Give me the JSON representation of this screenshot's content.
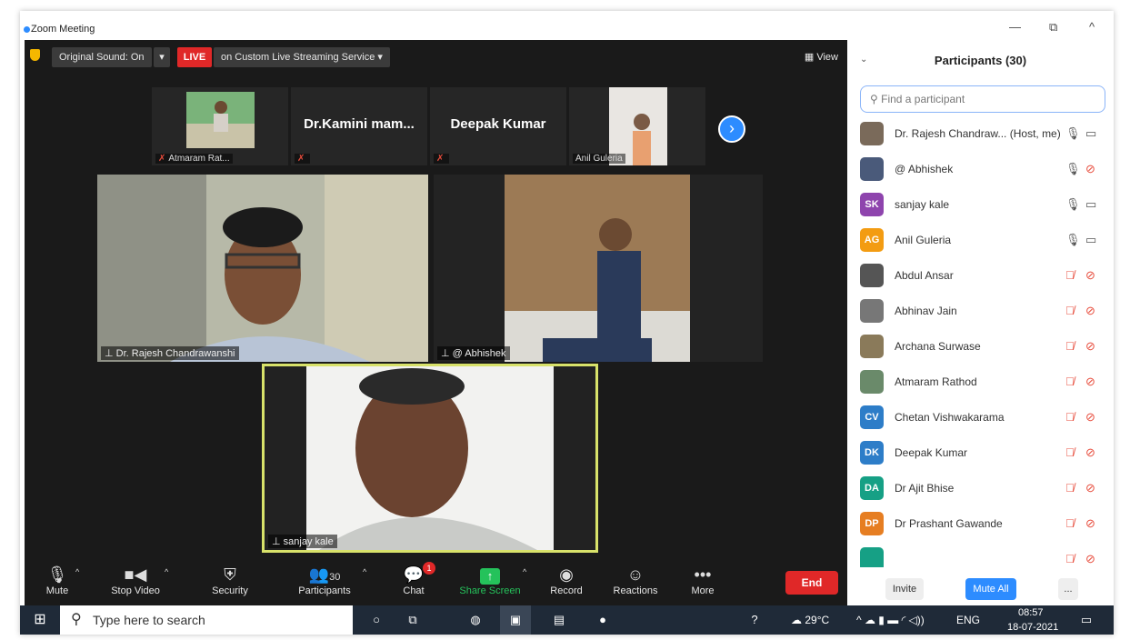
{
  "window": {
    "title": "Zoom Meeting",
    "minimize": "—",
    "restore": "⧉",
    "collapse": "^"
  },
  "topbar": {
    "sound": "Original Sound: On",
    "sound_caret": "▾",
    "live": "LIVE",
    "streaming": "on Custom Live Streaming Service  ▾",
    "view": "View"
  },
  "strip": [
    {
      "label": "Atmaram Rat...",
      "muted": true,
      "type": "video"
    },
    {
      "name": "Dr.Kamini  mam...",
      "muted": true,
      "type": "name"
    },
    {
      "name": "Deepak Kumar",
      "muted": true,
      "type": "name"
    },
    {
      "label": "Anil Guleria",
      "muted": false,
      "type": "video"
    }
  ],
  "strip_next": "›",
  "tiles": [
    {
      "label": "Dr. Rajesh Chandrawanshi"
    },
    {
      "label": "@ Abhishek"
    },
    {
      "label": "sanjay kale"
    }
  ],
  "pin_icon": "⊥",
  "toolbar": {
    "mute": "Mute",
    "stop_video": "Stop Video",
    "security": "Security",
    "participants": "Participants",
    "participants_count": "30",
    "chat": "Chat",
    "chat_badge": "1",
    "share_screen": "Share Screen",
    "record": "Record",
    "reactions": "Reactions",
    "more": "More",
    "end": "End"
  },
  "panel": {
    "title": "Participants (30)",
    "search_placeholder": "Find a participant",
    "participants": [
      {
        "name": "Dr. Rajesh Chandraw...  (Host, me)",
        "initials": "",
        "color": "#7a6a5a",
        "muted": false,
        "cam_off": false
      },
      {
        "name": "@ Abhishek",
        "initials": "",
        "color": "#4a5a7a",
        "muted": false,
        "cam_off": true
      },
      {
        "name": "sanjay kale",
        "initials": "SK",
        "color": "#8e44ad",
        "muted": false,
        "cam_off": false
      },
      {
        "name": "Anil Guleria",
        "initials": "AG",
        "color": "#f39c12",
        "muted": false,
        "cam_off": false
      },
      {
        "name": "Abdul Ansar",
        "initials": "",
        "color": "#555555",
        "muted": true,
        "cam_off": true
      },
      {
        "name": "Abhinav Jain",
        "initials": "",
        "color": "#777777",
        "muted": true,
        "cam_off": true
      },
      {
        "name": "Archana Surwase",
        "initials": "",
        "color": "#8a7a5a",
        "muted": true,
        "cam_off": true
      },
      {
        "name": "Atmaram Rathod",
        "initials": "",
        "color": "#6a8a6a",
        "muted": true,
        "cam_off": true
      },
      {
        "name": "Chetan Vishwakarama",
        "initials": "CV",
        "color": "#2d7dc8",
        "muted": true,
        "cam_off": true
      },
      {
        "name": "Deepak Kumar",
        "initials": "DK",
        "color": "#2d7dc8",
        "muted": true,
        "cam_off": true
      },
      {
        "name": "Dr Ajit Bhise",
        "initials": "DA",
        "color": "#16a085",
        "muted": true,
        "cam_off": true
      },
      {
        "name": "Dr Prashant Gawande",
        "initials": "DP",
        "color": "#e67e22",
        "muted": true,
        "cam_off": true
      },
      {
        "name": "",
        "initials": "",
        "color": "#16a085",
        "muted": true,
        "cam_off": true
      }
    ],
    "invite": "Invite",
    "mute_all": "Mute All",
    "more": "..."
  },
  "taskbar": {
    "search": "Type here to search",
    "temperature": "29°C",
    "language": "ENG",
    "time": "08:57",
    "date": "18-07-2021"
  }
}
